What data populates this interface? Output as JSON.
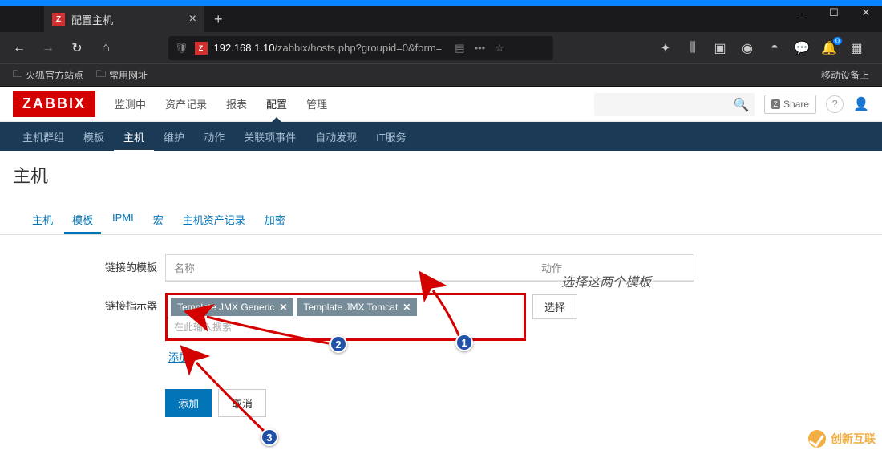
{
  "browser": {
    "tab_title": "配置主机",
    "url_prefix": "192.168.1.10",
    "url_path": "/zabbix/hosts.php?groupid=0&form=",
    "bookmarks": {
      "b1": "火狐官方站点",
      "b2": "常用网址",
      "right": "移动设备上"
    },
    "notification_count": "0"
  },
  "zabbix": {
    "logo": "ZABBIX",
    "top_menu": {
      "m1": "监测中",
      "m2": "资产记录",
      "m3": "报表",
      "m4": "配置",
      "m5": "管理"
    },
    "share": "Share",
    "sub_nav": {
      "s1": "主机群组",
      "s2": "模板",
      "s3": "主机",
      "s4": "维护",
      "s5": "动作",
      "s6": "关联项事件",
      "s7": "自动发现",
      "s8": "IT服务"
    },
    "page_title": "主机",
    "tabs": {
      "t1": "主机",
      "t2": "模板",
      "t3": "IPMI",
      "t4": "宏",
      "t5": "主机资产记录",
      "t6": "加密"
    },
    "form": {
      "linked_label": "链接的模板",
      "col_name": "名称",
      "col_action": "动作",
      "link_selector_label": "链接指示器",
      "tag1": "Template JMX Generic",
      "tag2": "Template JMX Tomcat",
      "input_placeholder": "在此输入搜索",
      "select_btn": "选择",
      "add_link": "添加",
      "submit_btn": "添加",
      "cancel_btn": "取消"
    },
    "annotation": "选择这两个模板",
    "badges": {
      "n1": "1",
      "n2": "2",
      "n3": "3"
    }
  },
  "watermark": "创新互联"
}
